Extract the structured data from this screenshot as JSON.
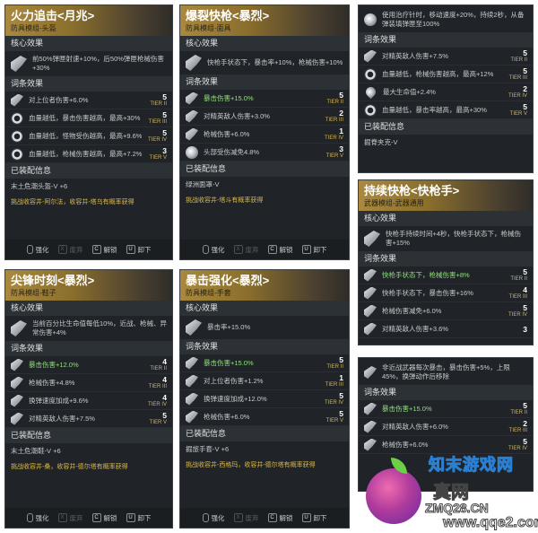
{
  "labels": {
    "core": "核心效果",
    "affix": "词条效果",
    "equipped": "已装配信息",
    "tier_prefix": "TIER"
  },
  "footer": {
    "strengthen": "强化",
    "discard": "废弃",
    "discard_key": "X",
    "unlock": "解锁",
    "unlock_key": "C",
    "unload": "卸下",
    "unload_key": "U"
  },
  "card1": {
    "title": "火力追击<月兆>",
    "subtitle": "防具模组-头盔",
    "core": "前50%弹匣射速+10%，后50%弹匣枪械伤害+30%",
    "rows": [
      {
        "text": "对上位者伤害+6.0%",
        "num": "5",
        "tier": "TIER II"
      },
      {
        "text": "血量越低，暴击伤害越高，最高+30%",
        "num": "5",
        "tier": "TIER III"
      },
      {
        "text": "血量越低，怪物受伤越高，最高+9.6%",
        "num": "5",
        "tier": "TIER IV"
      },
      {
        "text": "血量越低，枪械伤害越高，最高+7.2%",
        "num": "3",
        "tier": "TIER V"
      }
    ],
    "equipped": "末土危潮头盔-V +6",
    "obtain": "挑战收容井-阿尔法，收容井-塔乌有概率获得"
  },
  "card2": {
    "title": "爆裂快枪<暴烈>",
    "subtitle": "防具模组-面具",
    "core": "快枪手状态下，暴击率+10%，枪械伤害+10%",
    "rows": [
      {
        "text": "暴击伤害+15.0%",
        "num": "5",
        "tier": "TIER II",
        "hl": true
      },
      {
        "text": "对精英敌人伤害+3.0%",
        "num": "2",
        "tier": "TIER III"
      },
      {
        "text": "枪械伤害+6.0%",
        "num": "1",
        "tier": "TIER IV"
      },
      {
        "text": "头部受伤减免4.8%",
        "num": "3",
        "tier": "TIER V"
      }
    ],
    "equipped": "绿洲面罩-V",
    "obtain": "挑战收容井-塔斗有概率获得"
  },
  "card3": {
    "core": "使用治疗针时，移动速度+20%，持续2秒，从备弹装填弹匣至100%",
    "rows": [
      {
        "text": "对精英敌人伤害+7.5%",
        "num": "5",
        "tier": "TIER II"
      },
      {
        "text": "血量越低，枪械伤害越高，最高+12%",
        "num": "5",
        "tier": "TIER III"
      },
      {
        "text": "最大生命值+2.4%",
        "num": "2",
        "tier": "TIER IV"
      },
      {
        "text": "血量越低，暴击率越高，最高+30%",
        "num": "5",
        "tier": "TIER V"
      }
    ],
    "equipped": "掘脊夹克-V"
  },
  "card4": {
    "title": "持续快枪<快枪手>",
    "subtitle": "武器模组-武器通用",
    "core": "快枪手持续时间+4秒，快枪手状态下，枪械伤害+15%",
    "rows": [
      {
        "text": "快枪手状态下，枪械伤害+8%",
        "num": "5",
        "tier": "TIER II",
        "hl": true
      },
      {
        "text": "快枪手状态下，暴击伤害+16%",
        "num": "4",
        "tier": "TIER III"
      },
      {
        "text": "枪械伤害减免+6.0%",
        "num": "5",
        "tier": "TIER IV"
      },
      {
        "text": "对精英敌人伤害+3.6%",
        "num": "3",
        "tier": ""
      }
    ]
  },
  "card5": {
    "title": "尖锋时刻<暴烈>",
    "subtitle": "防具模组-鞋子",
    "core": "当前百分比生命值每低10%，近战、枪械、异常伤害+4%",
    "rows": [
      {
        "text": "暴击伤害+12.0%",
        "num": "4",
        "tier": "TIER II",
        "hl": true
      },
      {
        "text": "枪械伤害+4.8%",
        "num": "4",
        "tier": "TIER III"
      },
      {
        "text": "换弹速度加成+9.6%",
        "num": "4",
        "tier": "TIER IV"
      },
      {
        "text": "对精英敌人伤害+7.5%",
        "num": "5",
        "tier": "TIER V"
      }
    ],
    "equipped": "末土危潮鞋-V +6",
    "obtain": "挑战收容井-桑，收容井-德尔塔有概率获得"
  },
  "card6": {
    "title": "暴击强化<暴烈>",
    "subtitle": "防具模组-手套",
    "core": "暴击率+15.0%",
    "rows": [
      {
        "text": "暴击伤害+15.0%",
        "num": "5",
        "tier": "TIER II",
        "hl": true
      },
      {
        "text": "对上位者伤害+1.2%",
        "num": "1",
        "tier": "TIER III"
      },
      {
        "text": "换弹速度加成+12.0%",
        "num": "5",
        "tier": "TIER IV"
      },
      {
        "text": "枪械伤害+6.0%",
        "num": "5",
        "tier": "TIER V"
      }
    ],
    "equipped": "掘旅手套-V +6",
    "obtain": "挑战收容井-西格玛，收容井-德尔塔有概率获得"
  },
  "card7": {
    "core": "非近战武器每次暴击，暴击伤害+5%，上限45%，换弹动作后移除",
    "rows": [
      {
        "text": "暴击伤害+15.0%",
        "num": "5",
        "tier": "TIER II",
        "hl": true
      },
      {
        "text": "对精英敌人伤害+6.0%",
        "num": "2",
        "tier": "TIER III"
      },
      {
        "text": "枪械伤害+6.0%",
        "num": "5",
        "tier": "TIER IV"
      }
    ]
  },
  "watermark": {
    "cn": "知末游戏网",
    "zq": "真网",
    "url": "ZMQ28.CN",
    "url2": "www.qqe2.com"
  }
}
